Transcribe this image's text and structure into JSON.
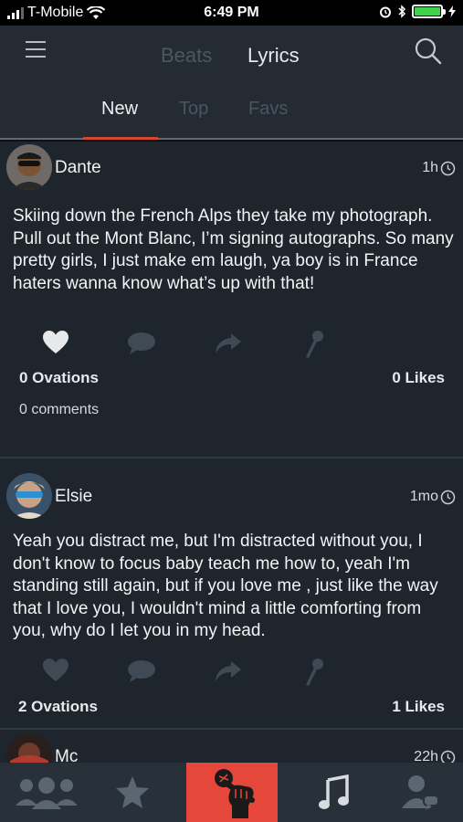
{
  "status_bar": {
    "carrier": "T-Mobile",
    "time": "6:49 PM"
  },
  "header": {
    "tabs": [
      "Beats",
      "Lyrics"
    ],
    "active_tab": "Lyrics"
  },
  "sub_tabs": {
    "items": [
      "New",
      "Top",
      "Favs"
    ],
    "active": "New"
  },
  "posts": [
    {
      "user": "Dante",
      "time": "1h",
      "text": "Skiing down the French Alps they take my photograph. Pull out the Mont Blanc, I’m signing autographs. So many pretty girls, I just make em laugh, ya boy is in France haters wanna know what’s up with that!",
      "ovations": "0 Ovations",
      "likes": "0 Likes",
      "comments": "0 comments",
      "liked": true
    },
    {
      "user": "Elsie",
      "time": "1mo",
      "text": "Yeah you distract me, but I'm distracted without you, I don't know to focus baby teach me how to, yeah I'm standing still again, but if you love me , just like the way that I love you, I wouldn't mind a little comforting from you, why do I let you in my head.",
      "ovations": "2 Ovations",
      "likes": "1 Likes",
      "liked": false
    },
    {
      "user": "Mc",
      "time": "22h"
    }
  ],
  "icons": {
    "menu": "hamburger-icon",
    "search": "search-icon",
    "like": "heart-icon",
    "comment": "comment-icon",
    "share": "share-icon",
    "mic": "microphone-icon",
    "bottom_nav": [
      "people-icon",
      "star-icon",
      "fist-mic-icon",
      "music-note-icon",
      "profile-chat-icon"
    ]
  },
  "colors": {
    "accent": "#e5483a",
    "nav_bg": "#242b33",
    "feed_bg": "#1e252c",
    "battery": "#3fd24a"
  }
}
